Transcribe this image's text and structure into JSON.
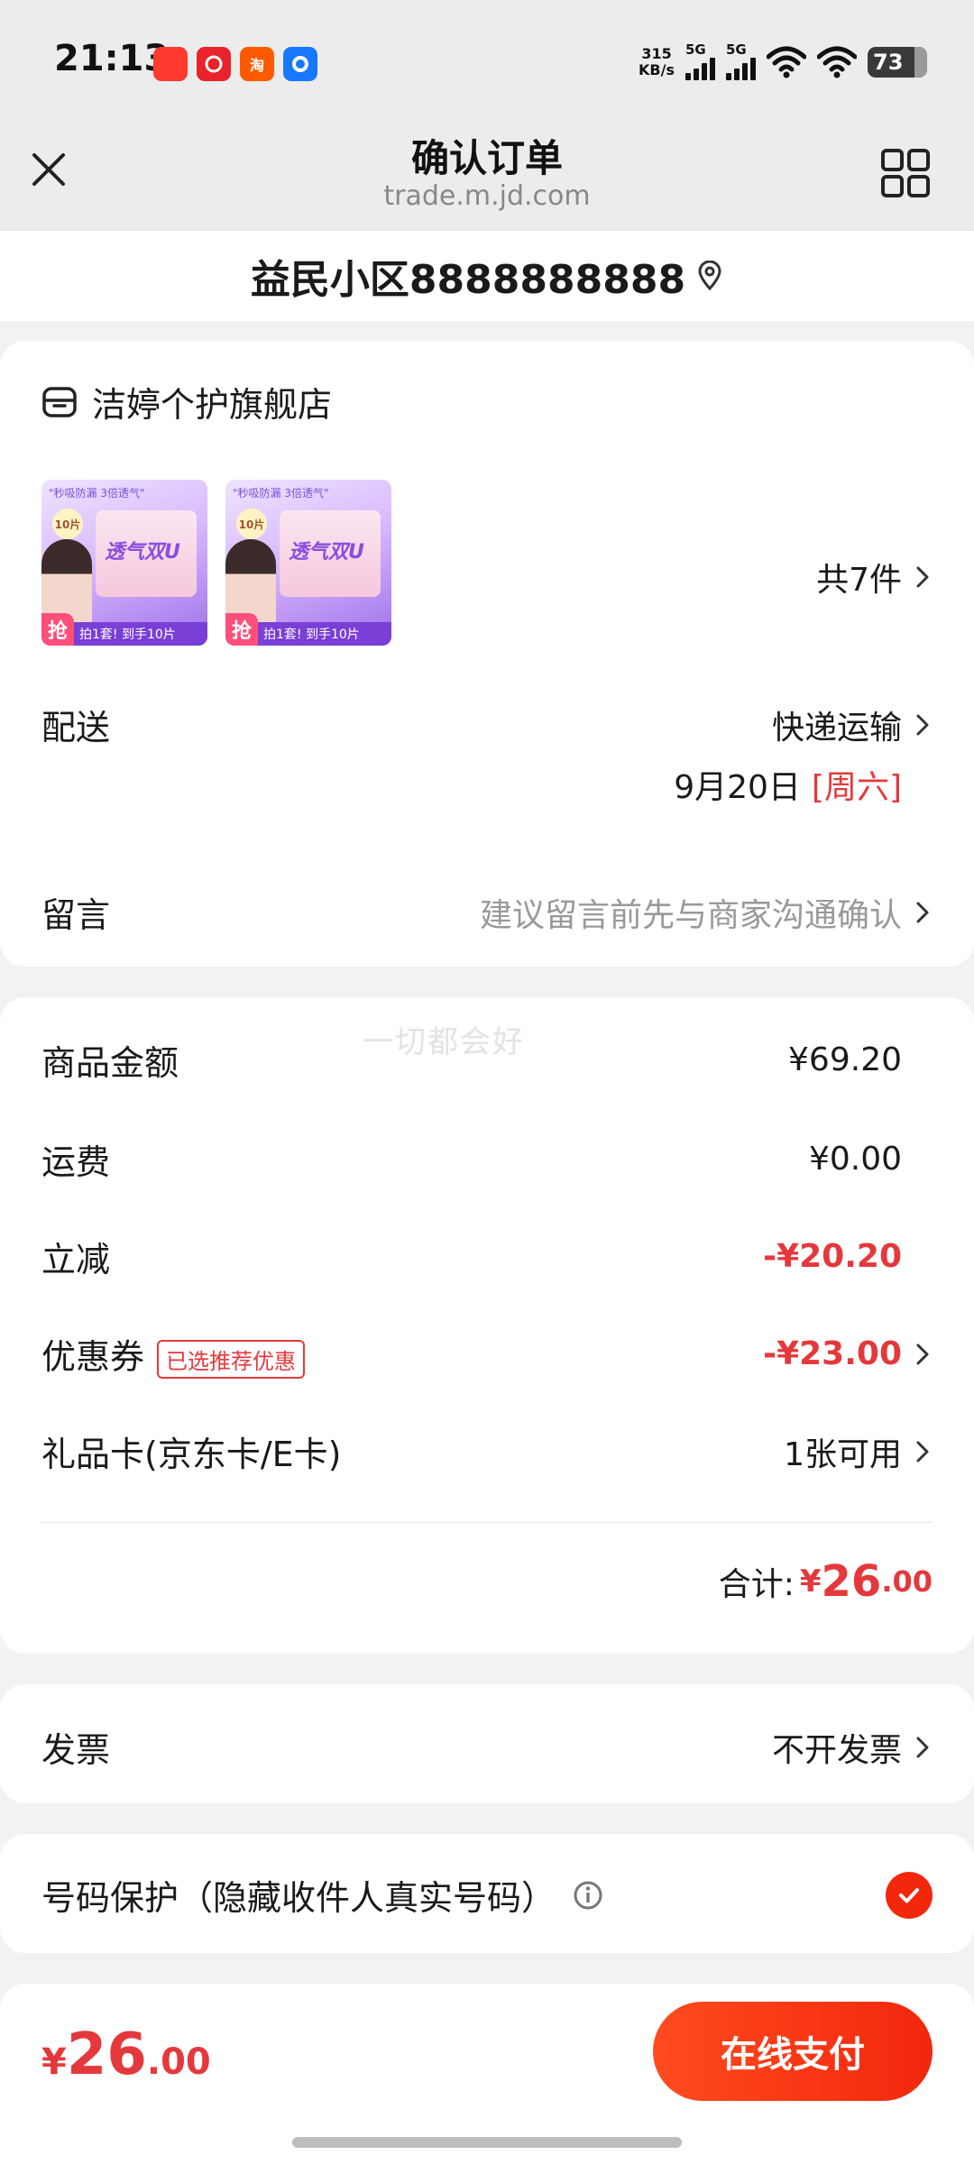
{
  "status_bar": {
    "time": "21:13",
    "net_speed_value": "315",
    "net_speed_unit": "KB/s",
    "signal_1_label": "5G",
    "signal_2_label": "5G",
    "battery": "73",
    "app_icons": [
      {
        "name": "app-icon-1",
        "color": "#ff3b30",
        "text": ""
      },
      {
        "name": "netease-music-icon",
        "color": "#e8232a",
        "text": ""
      },
      {
        "name": "taobao-icon",
        "color": "#ff5a00",
        "text": "淘"
      },
      {
        "name": "alipay-icon",
        "color": "#1677ff",
        "text": ""
      }
    ]
  },
  "header": {
    "title": "确认订单",
    "url": "trade.m.jd.com",
    "close_icon": "close-icon",
    "grid_icon": "grid-icon"
  },
  "address": {
    "text": "益民小区8888888888",
    "icon": "location-pin-icon"
  },
  "store": {
    "name": "洁婷个护旗舰店",
    "icon": "store-icon",
    "products": [
      {
        "top_text": "\"秒吸防漏 3倍透气\"",
        "pack_text": "透气双U",
        "badge": "10片",
        "grab": "抢",
        "strip_text": "拍1套! 到手10片"
      },
      {
        "top_text": "\"秒吸防漏 3倍透气\"",
        "pack_text": "透气双U",
        "badge": "10片",
        "grab": "抢",
        "strip_text": "拍1套! 到手10片"
      }
    ],
    "item_count": "共7件"
  },
  "delivery": {
    "label": "配送",
    "method": "快递运输",
    "date": "9月20日",
    "weekday": "[周六]"
  },
  "message": {
    "label": "留言",
    "placeholder": "建议留言前先与商家沟通确认"
  },
  "price_summary": {
    "watermark": "一切都会好",
    "goods_amount_label": "商品金额",
    "goods_amount": "¥69.20",
    "shipping_label": "运费",
    "shipping": "¥0.00",
    "instant_discount_label": "立减",
    "instant_discount": "-¥20.20",
    "coupon_label": "优惠券",
    "coupon_tag": "已选推荐优惠",
    "coupon_value": "-¥23.00",
    "gift_card_label": "礼品卡(京东卡/E卡)",
    "gift_card_value": "1张可用",
    "total_label": "合计:",
    "total_symbol": "¥",
    "total_int": "26",
    "total_dec": ".00"
  },
  "invoice": {
    "label": "发票",
    "value": "不开发票"
  },
  "privacy": {
    "label": "号码保护（隐藏收件人真实号码）",
    "checked": true
  },
  "bottom": {
    "price_symbol": "¥",
    "price_int": "26",
    "price_dec": ".00",
    "pay_button": "在线支付"
  },
  "colors": {
    "accent_red": "#e4393c",
    "pay_red": "#f2270c",
    "page_bg": "#f2f2f2"
  }
}
